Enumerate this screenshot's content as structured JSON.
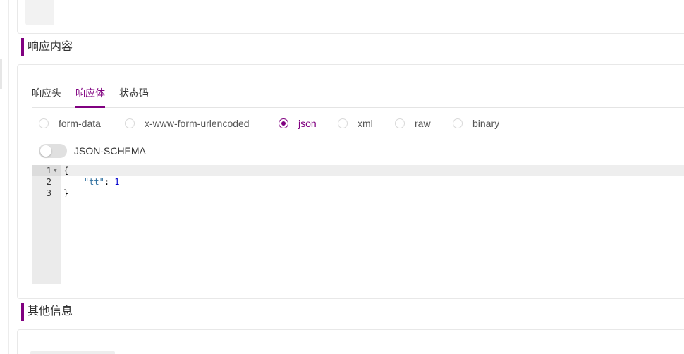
{
  "section_response": {
    "title": "响应内容"
  },
  "section_other": {
    "title": "其他信息"
  },
  "tabs": [
    {
      "label": "响应头",
      "active": false
    },
    {
      "label": "响应体",
      "active": true
    },
    {
      "label": "状态码",
      "active": false
    }
  ],
  "body_types": [
    {
      "label": "form-data",
      "checked": false
    },
    {
      "label": "x-www-form-urlencoded",
      "checked": false
    },
    {
      "label": "json",
      "checked": true
    },
    {
      "label": "xml",
      "checked": false
    },
    {
      "label": "raw",
      "checked": false
    },
    {
      "label": "binary",
      "checked": false
    }
  ],
  "json_schema_toggle": {
    "label": "JSON-SCHEMA",
    "on": false
  },
  "editor": {
    "line_numbers": [
      "1",
      "2",
      "3"
    ],
    "lines": {
      "open_brace": "{",
      "key": "\"tt\"",
      "colon": ": ",
      "value": "1",
      "close_brace": "}"
    }
  },
  "colors": {
    "accent": "#800080",
    "gutter": "#ebebeb"
  },
  "icons": {
    "fold": "triangle-down"
  }
}
